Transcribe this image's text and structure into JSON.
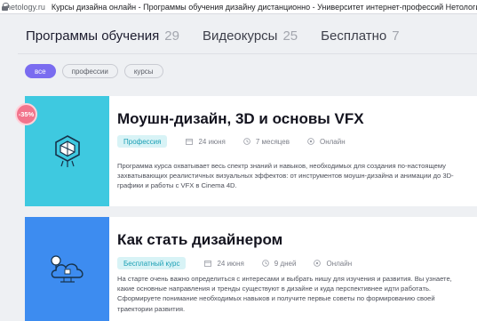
{
  "browser": {
    "url": "netology.ru",
    "page_title": "Курсы дизайна онлайн - Программы обучения дизайну дистанционно - Университет интернет-профессий Нетология"
  },
  "tabs": [
    {
      "label": "Программы обучения",
      "count": "29"
    },
    {
      "label": "Видеокурсы",
      "count": "25"
    },
    {
      "label": "Бесплатно",
      "count": "7"
    }
  ],
  "filters": [
    "все",
    "профессии",
    "курсы"
  ],
  "courses": [
    {
      "discount": "-35%",
      "title": "Моушн-дизайн, 3D и основы VFX",
      "tag": "Профессия",
      "date": "24 июня",
      "duration": "7 месяцев",
      "format": "Онлайн",
      "desc": [
        "Программа курса охватывает весь спектр знаний и навыков, необходимых для создания по-настоящему",
        "захватывающих реалистичных визуальных эффектов: от инструментов моушн-дизайна и анимации до 3D-",
        "графики и работы с VFX в Cinema 4D."
      ]
    },
    {
      "title": "Как стать дизайнером",
      "tag": "Бесплатный курс",
      "date": "24 июня",
      "duration": "9 дней",
      "format": "Онлайн",
      "desc": [
        "На старте очень важно определиться с интересами и выбрать нишу для изучения и развития. Вы узнаете,",
        "какие основные направления и тренды существуют в дизайне и куда перспективнее идти работать.",
        "Сформируете понимание необходимых навыков и получите первые советы по формированию своей",
        "траектории развития."
      ]
    }
  ],
  "colors": {
    "accent": "#7a6cf0",
    "card1_thumb": "#3ec9e0",
    "card2_thumb": "#3d8cf0",
    "discount_badge": "#f2748c",
    "tag_bg": "#d8f3f6",
    "tag_text": "#1a9fb4"
  },
  "icons": [
    "lock-icon",
    "calendar-icon",
    "clock-icon",
    "online-icon",
    "course-illustration-icon"
  ]
}
